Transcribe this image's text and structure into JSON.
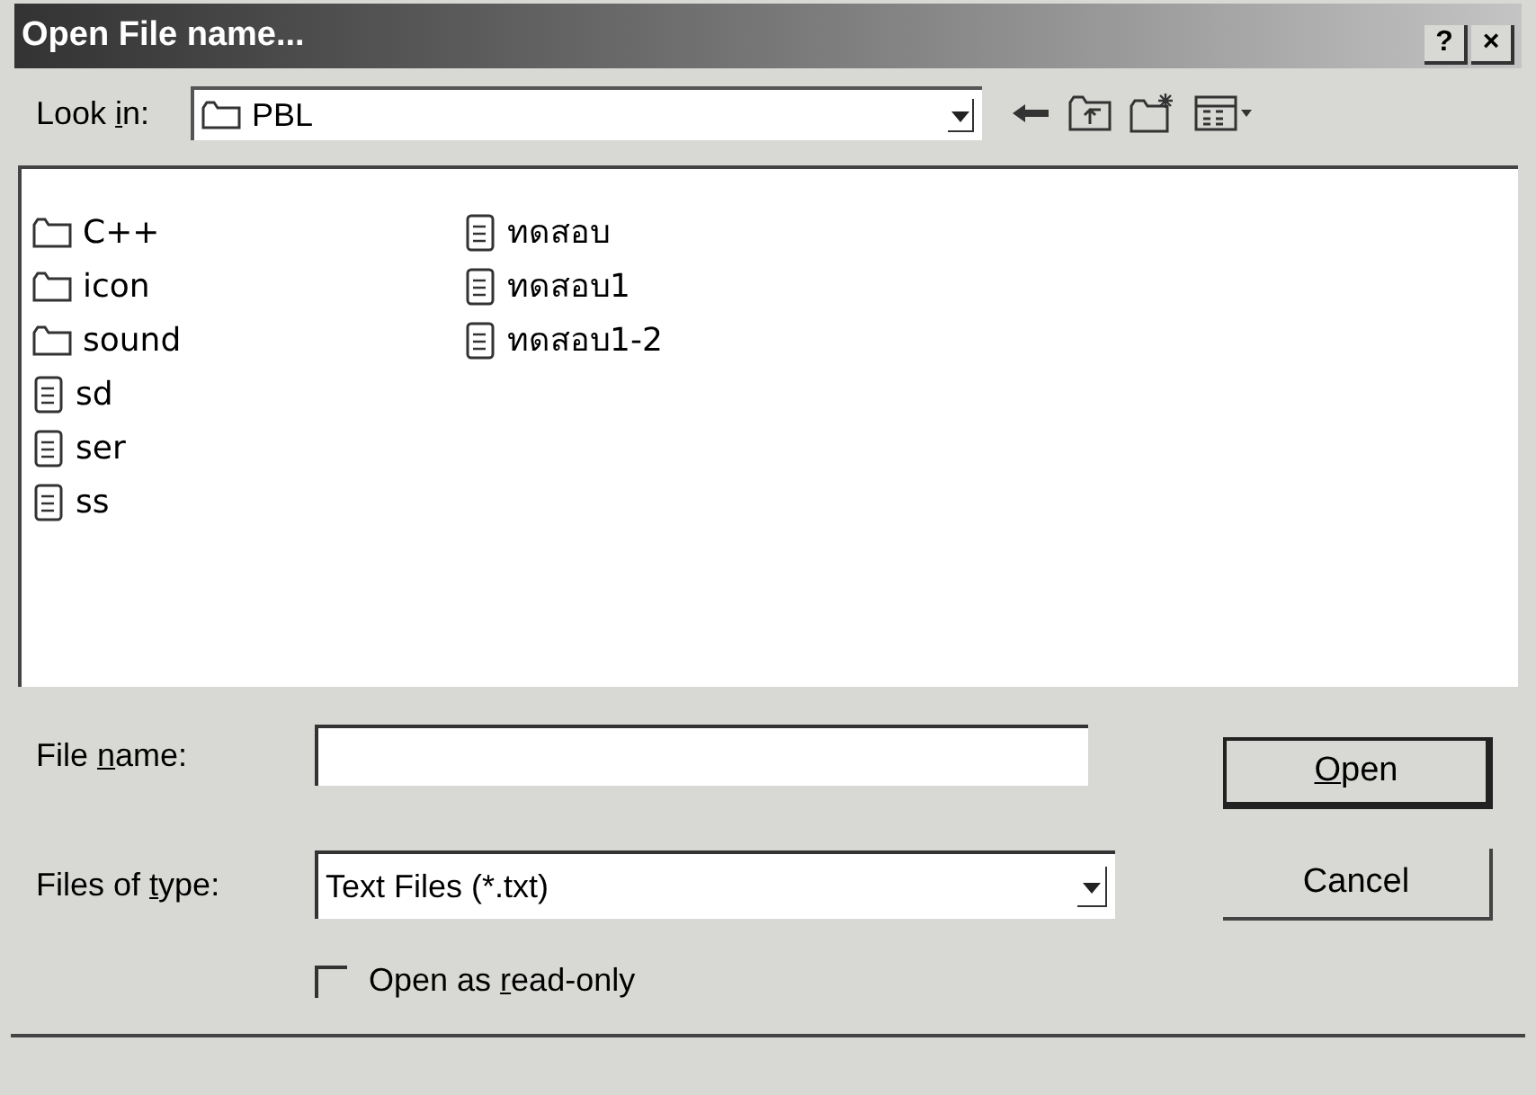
{
  "window": {
    "title": "Open File name...",
    "buttons": [
      "?",
      "×"
    ]
  },
  "look_in": {
    "label_parts": {
      "pre": "Look ",
      "key": "i",
      "post": "n:"
    },
    "value": "PBL"
  },
  "files": [
    {
      "kind": "folder",
      "name": "C++"
    },
    {
      "kind": "folder",
      "name": "icon"
    },
    {
      "kind": "folder",
      "name": "sound"
    },
    {
      "kind": "file",
      "name": "sd"
    },
    {
      "kind": "file",
      "name": "ser"
    },
    {
      "kind": "file",
      "name": "ss"
    },
    {
      "kind": "file",
      "name": "ทดสอบ"
    },
    {
      "kind": "file",
      "name": "ทดสอบ1"
    },
    {
      "kind": "file",
      "name": "ทดสอบ1-2"
    }
  ],
  "file_name": {
    "label_parts": {
      "pre": "File ",
      "key": "n",
      "post": "ame:"
    }
  },
  "files_of_type": {
    "label_parts": {
      "pre": "Files of ",
      "key": "t",
      "post": "ype:"
    },
    "value": "Text Files (*.txt)"
  },
  "read_only": {
    "label_parts": {
      "pre": "Open as ",
      "key": "r",
      "post": "ead-only"
    },
    "checked": false
  },
  "buttons": [
    {
      "label_parts": {
        "key": "O",
        "post": "pen"
      },
      "default": true
    },
    {
      "label_parts": {
        "pre": "Cancel"
      },
      "default": false
    }
  ]
}
